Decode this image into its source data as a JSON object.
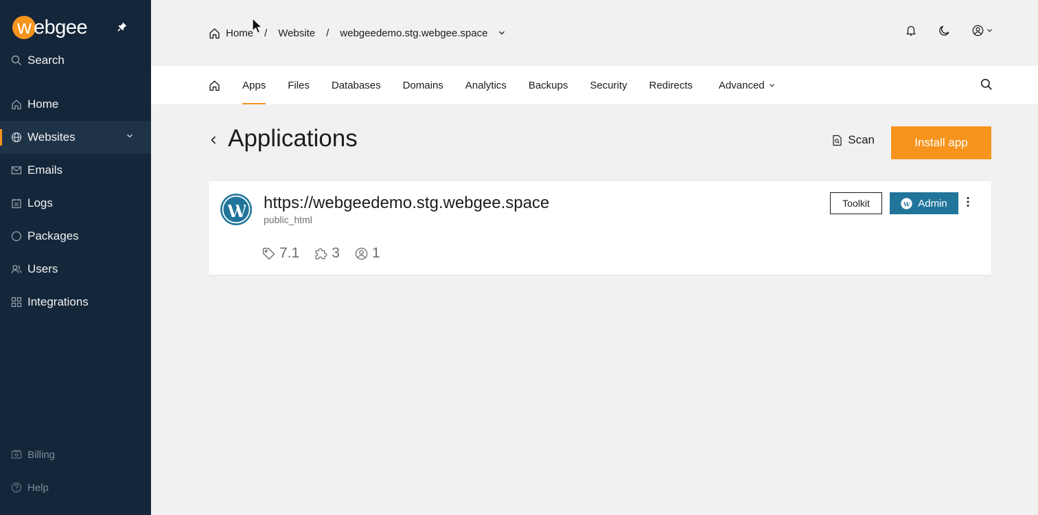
{
  "brand": {
    "logo_letter": "w",
    "logo_text": "ebgee",
    "accent": "#f7941d",
    "sidebar_bg": "#14263a"
  },
  "sidebar": {
    "search_label": "Search",
    "items": [
      {
        "label": "Home",
        "icon": "home-icon"
      },
      {
        "label": "Websites",
        "icon": "globe-icon",
        "active": true
      },
      {
        "label": "Emails",
        "icon": "mail-icon"
      },
      {
        "label": "Logs",
        "icon": "logs-icon"
      },
      {
        "label": "Packages",
        "icon": "circle-icon"
      },
      {
        "label": "Users",
        "icon": "users-icon"
      },
      {
        "label": "Integrations",
        "icon": "grid-icon"
      }
    ],
    "bottom": [
      {
        "label": "Billing",
        "icon": "billing-icon"
      },
      {
        "label": "Help",
        "icon": "help-icon"
      }
    ]
  },
  "breadcrumb": {
    "home": "Home",
    "separator": "/",
    "website": "Website",
    "domain": "webgeedemo.stg.webgee.space"
  },
  "tabs": [
    {
      "label": "Apps",
      "active": true
    },
    {
      "label": "Files"
    },
    {
      "label": "Databases"
    },
    {
      "label": "Domains"
    },
    {
      "label": "Analytics"
    },
    {
      "label": "Backups"
    },
    {
      "label": "Security"
    },
    {
      "label": "Redirects"
    },
    {
      "label": "Advanced",
      "dropdown": true
    }
  ],
  "page": {
    "title": "Applications",
    "scan_label": "Scan",
    "install_label": "Install app"
  },
  "app": {
    "url": "https://webgeedemo.stg.webgee.space",
    "path": "public_html",
    "version": "7.1",
    "plugins": "3",
    "users": "1",
    "toolkit_label": "Toolkit",
    "admin_label": "Admin",
    "wp_color": "#21759b"
  }
}
